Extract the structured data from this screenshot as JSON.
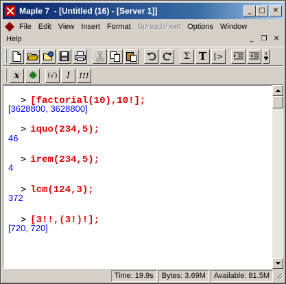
{
  "window": {
    "title": "Maple 7  - [Untitled (16) - [Server 1]]",
    "buttons": {
      "minimize": "_",
      "maximize": "□",
      "close": "✕"
    }
  },
  "menu": {
    "row1": [
      "File",
      "Edit",
      "View",
      "Insert",
      "Format",
      "Spreadsheet",
      "Options",
      "Window"
    ],
    "row1_disabled": [
      "Spreadsheet"
    ],
    "row2": [
      "Help"
    ],
    "mdi_buttons": {
      "minimize": "_",
      "restore": "❐",
      "close": "✕"
    }
  },
  "toolbar": {
    "text_labels": {
      "sigma": "Σ",
      "text": "T",
      "prompt": "[>"
    }
  },
  "toolbar2": {
    "labels": {
      "x": "x",
      "paren": "(√)",
      "exclaim": "!",
      "triple_exclaim": "!!!"
    }
  },
  "worksheet": {
    "prompt_symbol": ">",
    "lines": [
      {
        "type": "input",
        "text": "[factorial(10),10!];"
      },
      {
        "type": "output",
        "text": "[3628800, 3628800]"
      },
      {
        "type": "input",
        "text": "iquo(234,5);"
      },
      {
        "type": "output",
        "text": "46"
      },
      {
        "type": "input",
        "text": "irem(234,5);"
      },
      {
        "type": "output",
        "text": "4"
      },
      {
        "type": "input",
        "text": "lcm(124,3);"
      },
      {
        "type": "output",
        "text": "372"
      },
      {
        "type": "input",
        "text": "[3!!,(3!)!];"
      },
      {
        "type": "output",
        "text": "[720, 720]"
      }
    ]
  },
  "status": {
    "time": "Time:  19.9s",
    "bytes": "Bytes: 3.69M",
    "available": "Available: 81.5M"
  },
  "colors": {
    "input": "#e00000",
    "output": "#0000ff",
    "titlebar": "#0a246a"
  }
}
